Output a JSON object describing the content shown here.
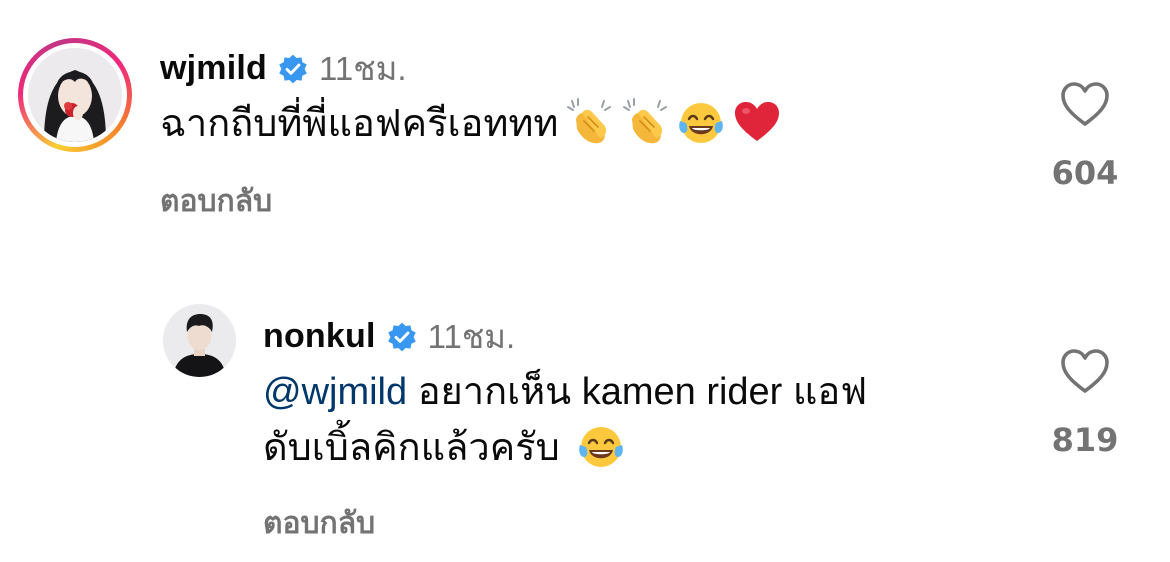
{
  "comments": [
    {
      "username": "wjmild",
      "verified": true,
      "time": "11ชม.",
      "text": "ฉากถีบที่พี่แอฟครีเอททท",
      "emojis": [
        "clapping-hands",
        "clapping-hands",
        "face-with-tears-of-joy",
        "red-heart"
      ],
      "reply_label": "ตอบกลับ",
      "likes": "604",
      "has_story_ring": true
    },
    {
      "username": "nonkul",
      "verified": true,
      "time": "11ชม.",
      "mention": "@wjmild",
      "text_line1": " อยากเห็น kamen rider แอฟ",
      "text_line2": "ดับเบิ้ลคิกแล้วครับ",
      "emojis": [
        "face-with-tears-of-joy"
      ],
      "reply_label": "ตอบกลับ",
      "likes": "819",
      "has_story_ring": false
    }
  ],
  "colors": {
    "text_primary": "#0a0a0a",
    "text_secondary": "#737373",
    "mention": "#00376b",
    "verified_badge": "#3897f0",
    "background": "#ffffff"
  }
}
